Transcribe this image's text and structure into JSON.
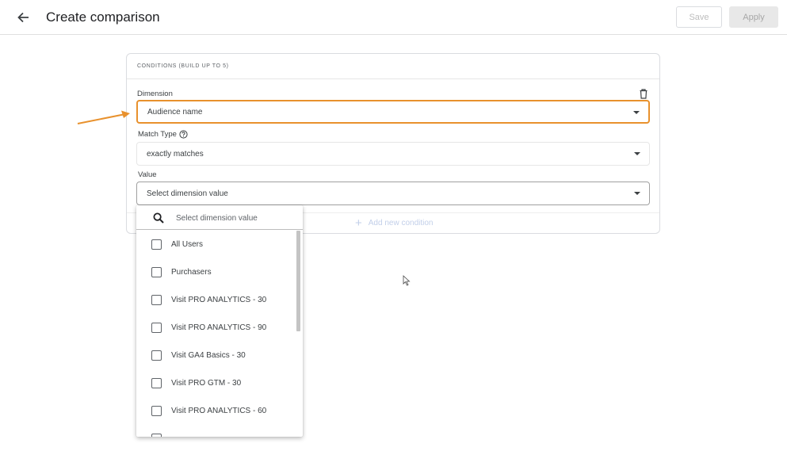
{
  "header": {
    "title": "Create comparison",
    "save_label": "Save",
    "apply_label": "Apply"
  },
  "conditions": {
    "section_title": "CONDITIONS (BUILD UP TO 5)",
    "dimension": {
      "label": "Dimension",
      "value": "Audience name"
    },
    "match_type": {
      "label": "Match Type",
      "value": "exactly matches"
    },
    "value": {
      "label": "Value",
      "placeholder": "Select dimension value"
    },
    "add_condition_label": "Add new condition"
  },
  "dropdown": {
    "search_placeholder": "Select dimension value",
    "items": [
      {
        "label": "All Users",
        "checked": false
      },
      {
        "label": "Purchasers",
        "checked": false
      },
      {
        "label": "Visit PRO ANALYTICS - 30",
        "checked": false
      },
      {
        "label": "Visit PRO ANALYTICS - 90",
        "checked": false
      },
      {
        "label": "Visit GA4 Basics - 30",
        "checked": false
      },
      {
        "label": "Visit PRO GTM - 30",
        "checked": false
      },
      {
        "label": "Visit PRO ANALYTICS - 60",
        "checked": false
      }
    ]
  },
  "colors": {
    "highlight": "#e8912d",
    "annotation_arrow": "#e8912d",
    "add_condition_text": "#c2cfe9"
  },
  "icons": [
    "back-arrow-icon",
    "trash-icon",
    "help-icon",
    "chevron-down-icon",
    "search-icon",
    "plus-icon",
    "mouse-cursor-icon"
  ]
}
